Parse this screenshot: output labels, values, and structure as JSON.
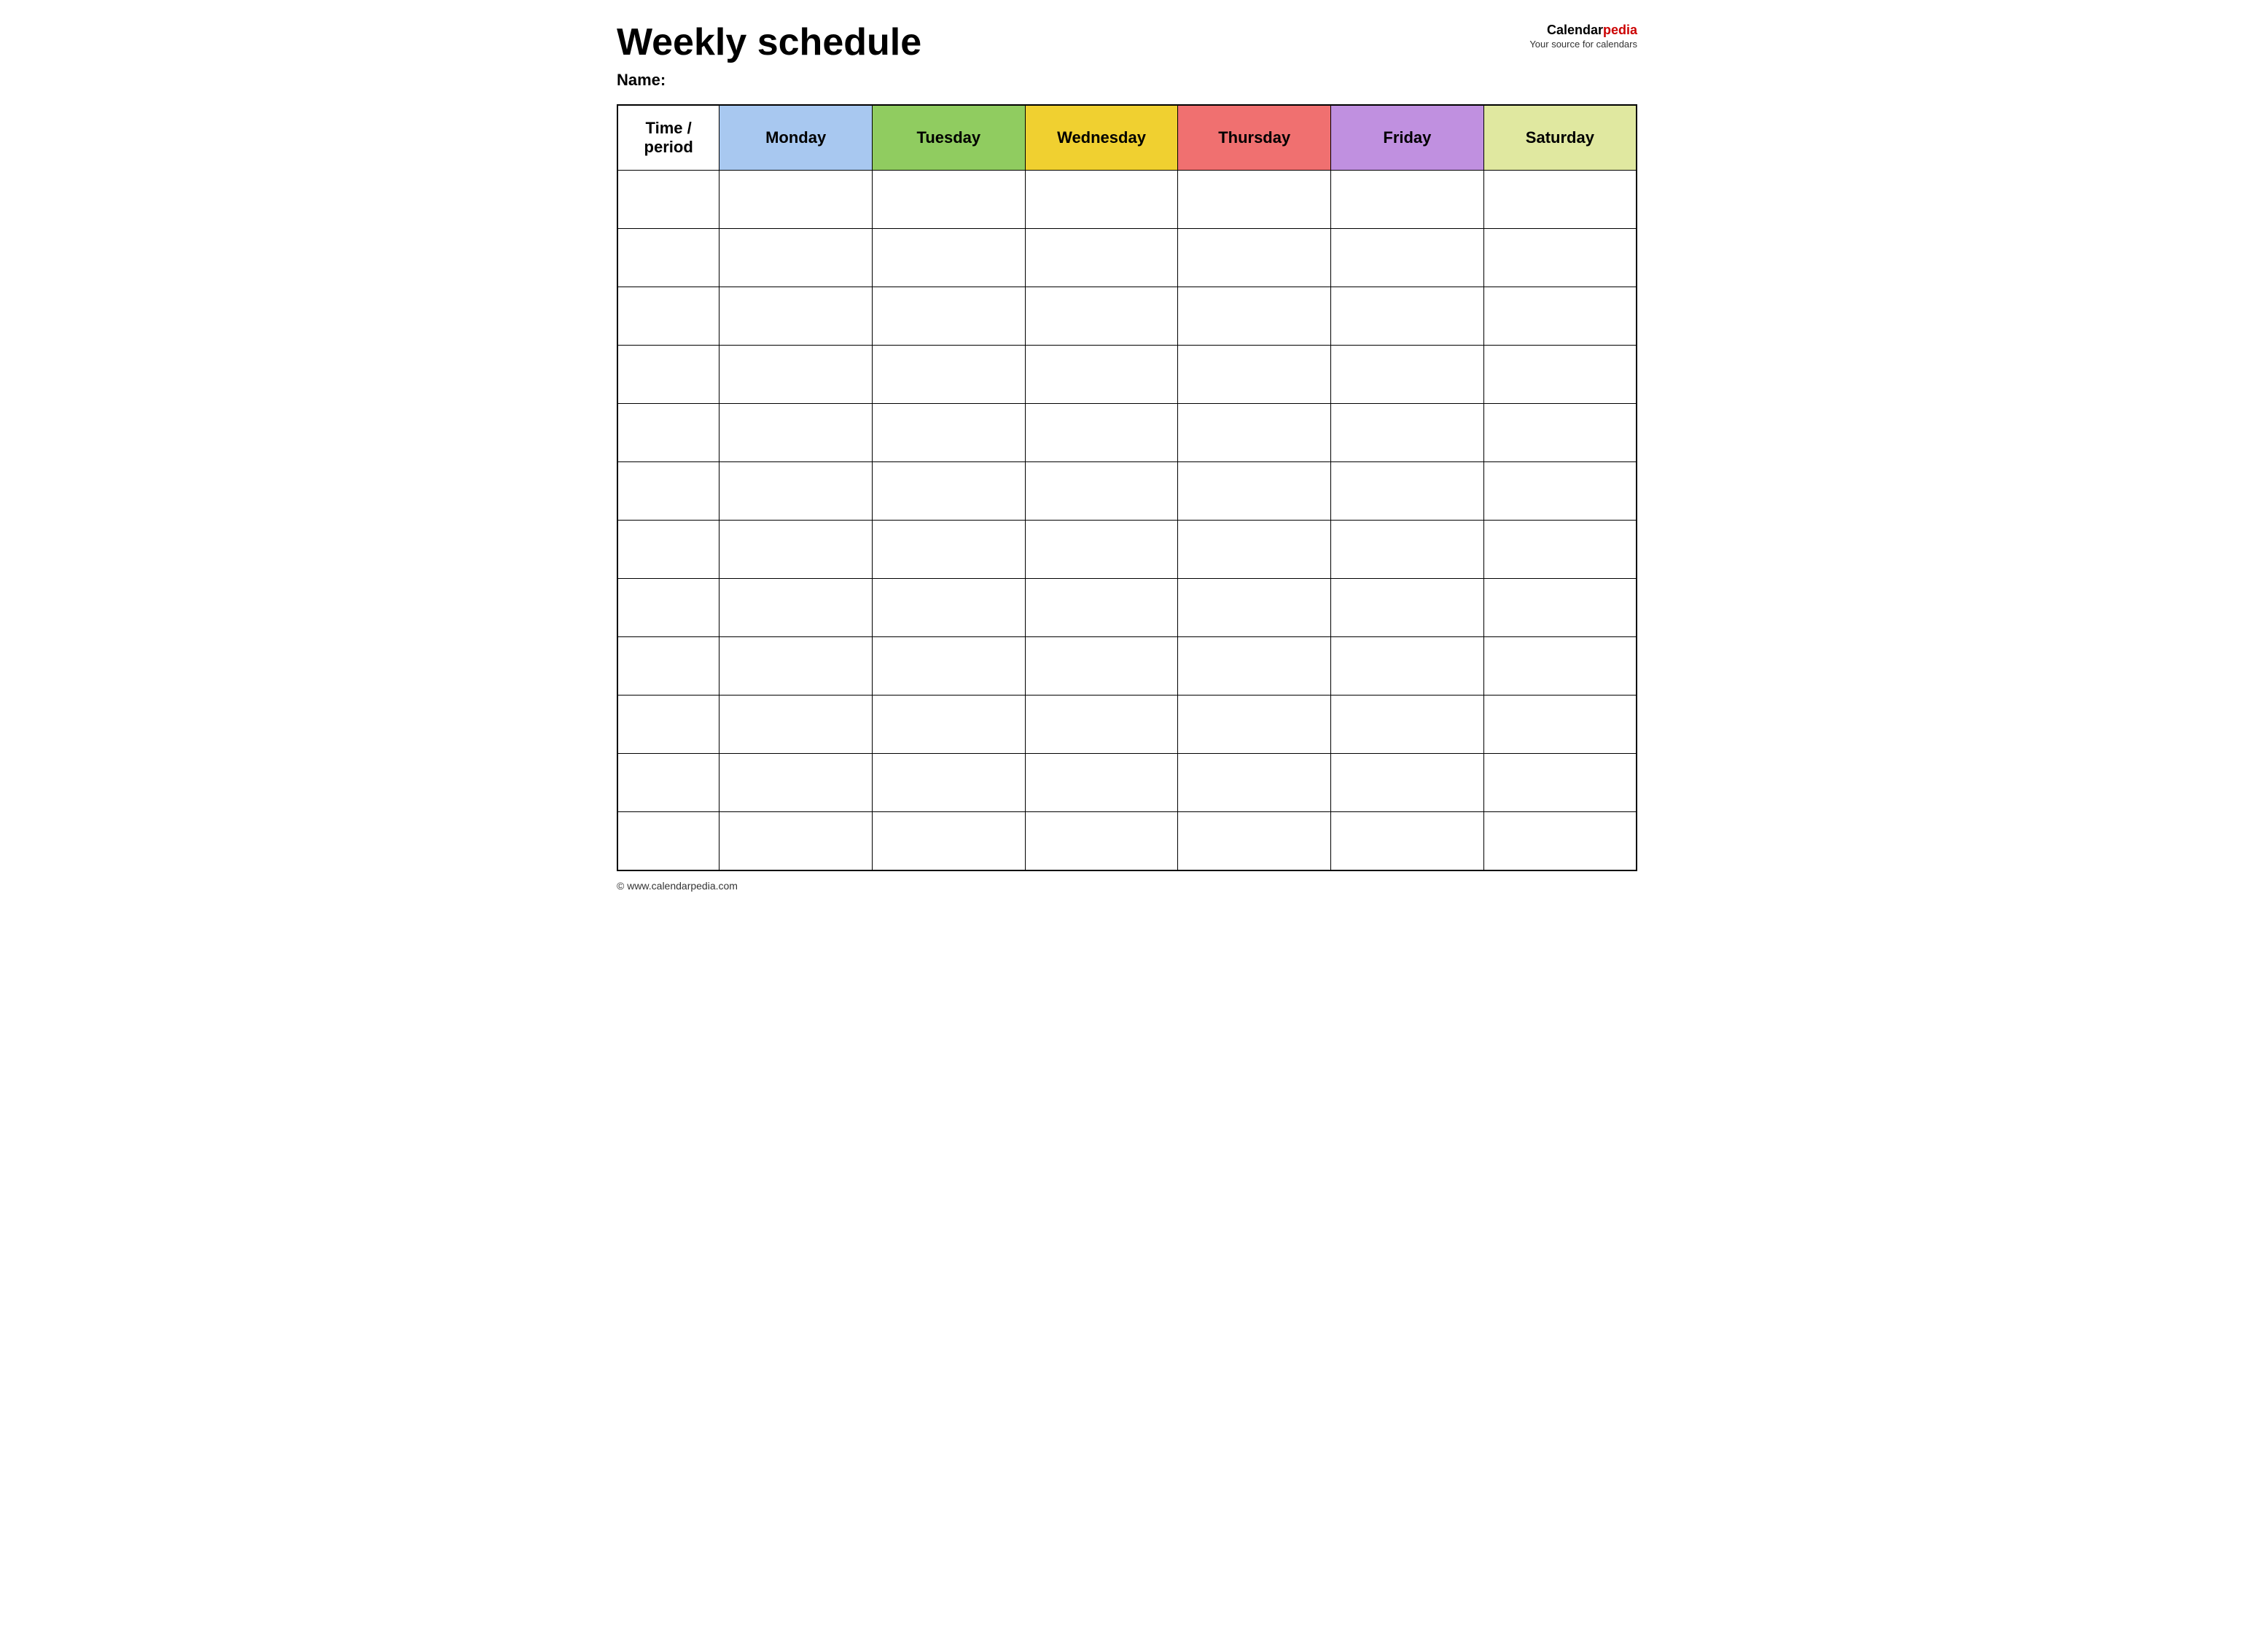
{
  "header": {
    "title": "Weekly schedule",
    "brand_name_calendar": "Calendar",
    "brand_name_pedia": "pedia",
    "brand_tagline": "Your source for calendars"
  },
  "name_label": "Name:",
  "table": {
    "columns": [
      {
        "key": "time",
        "label": "Time / period",
        "color_class": "col-time"
      },
      {
        "key": "monday",
        "label": "Monday",
        "color_class": "col-monday"
      },
      {
        "key": "tuesday",
        "label": "Tuesday",
        "color_class": "col-tuesday"
      },
      {
        "key": "wednesday",
        "label": "Wednesday",
        "color_class": "col-wednesday"
      },
      {
        "key": "thursday",
        "label": "Thursday",
        "color_class": "col-thursday"
      },
      {
        "key": "friday",
        "label": "Friday",
        "color_class": "col-friday"
      },
      {
        "key": "saturday",
        "label": "Saturday",
        "color_class": "col-saturday"
      }
    ],
    "row_count": 12
  },
  "footer": {
    "url": "© www.calendarpedia.com"
  }
}
